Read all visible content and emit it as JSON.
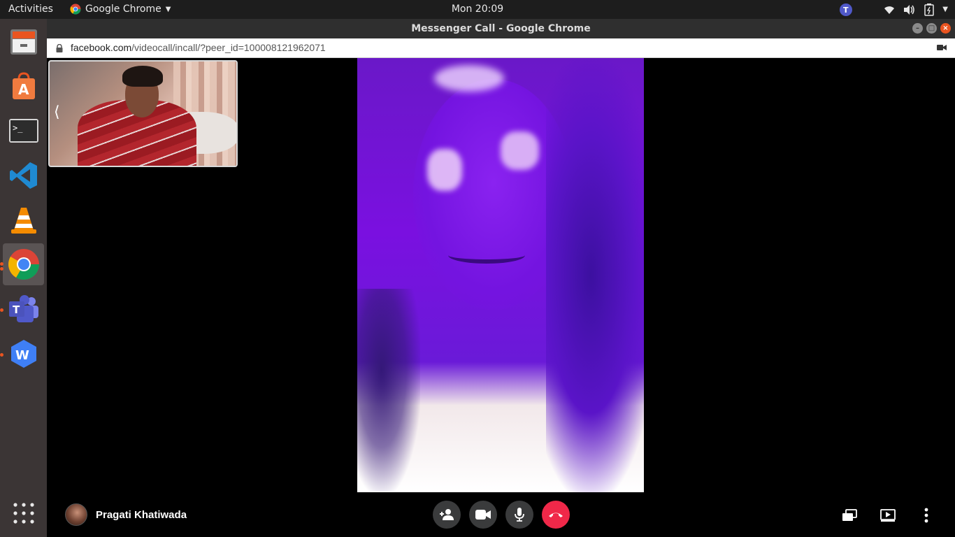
{
  "topbar": {
    "activities": "Activities",
    "app_name": "Google Chrome",
    "clock": "Mon 20:09"
  },
  "dock": {
    "items": [
      {
        "name": "Files",
        "icon": "files-icon"
      },
      {
        "name": "Ubuntu Software",
        "icon": "software-center-icon"
      },
      {
        "name": "Terminal",
        "icon": "terminal-icon"
      },
      {
        "name": "Visual Studio Code",
        "icon": "vscode-icon"
      },
      {
        "name": "VLC media player",
        "icon": "vlc-icon"
      },
      {
        "name": "Google Chrome",
        "icon": "chrome-icon",
        "active": true
      },
      {
        "name": "Microsoft Teams - Preview",
        "icon": "teams-icon"
      },
      {
        "name": "WPS Office",
        "icon": "wps-icon"
      }
    ],
    "show_apps_icon": "app-grid-icon"
  },
  "window": {
    "title": "Messenger Call - Google Chrome",
    "url_host": "facebook.com",
    "url_path": "/videocall/incall/?peer_id=100008121962071"
  },
  "call": {
    "caller_name": "Pragati Khatiwada",
    "controls": [
      "add-person",
      "video",
      "microphone",
      "end-call"
    ],
    "end_call_color": "#f02849"
  },
  "colors": {
    "ubuntu_orange": "#e95420",
    "dock_bg": "#3b3535",
    "topbar_bg": "#1d1d1d"
  }
}
